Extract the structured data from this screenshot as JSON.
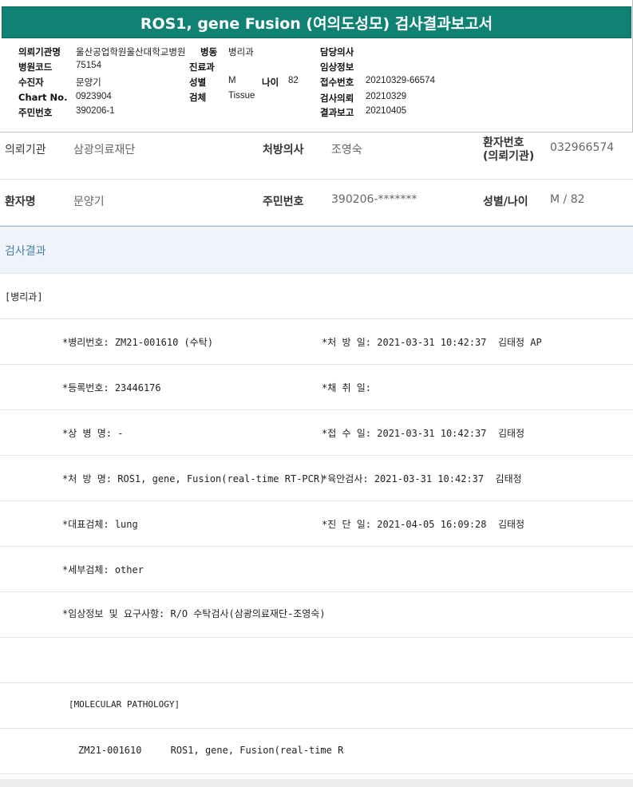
{
  "report": {
    "title": "ROS1, gene Fusion (여의도성모) 검사결과보고서"
  },
  "header": {
    "institution_label": "의뢰기관명",
    "institution_value": "울산공업학원울산대학교병원",
    "ward_label": "병동",
    "ward_value": "병리과",
    "doctor_label": "담당의사",
    "doctor_value": "",
    "hospital_code_label": "병원코드",
    "hospital_code_value": "75154",
    "department_label": "진료과",
    "department_value": "",
    "clinical_info_label": "임상정보",
    "clinical_info_value": "",
    "patient_label": "수진자",
    "patient_value": "문양기",
    "sex_label": "성별",
    "sex_value": "M",
    "age_label": "나이",
    "age_value": "82",
    "receipt_no_label": "접수번호",
    "receipt_no_value": "20210329-66574",
    "chart_label": "Chart No.",
    "chart_value": "0923904",
    "specimen_label": "검체",
    "specimen_value": "Tissue",
    "request_label": "검사의뢰",
    "request_value": "20210329",
    "resident_label": "주민번호",
    "resident_value": "390206-1",
    "result_report_label": "결과보고",
    "result_report_value": "20210405"
  },
  "info": {
    "institution_label": "의뢰기관",
    "institution_value": "삼광의료재단",
    "prescriber_label": "처방의사",
    "prescriber_value": "조영숙",
    "patient_no_label_1": "환자번호",
    "patient_no_label_2": "(의뢰기관)",
    "patient_no_value": "032966574",
    "patient_name_label": "환자명",
    "patient_name_value": "문양기",
    "resident_label": "주민번호",
    "resident_value": "390206-*******",
    "sexage_label": "성별/나이",
    "sexage_value": "M / 82"
  },
  "results": {
    "section_title": "검사결과",
    "department": "[병리과]",
    "pathology_no": "*병리번호: ZM21-001610 (수탁)",
    "prescribe_date": "*처 방 일: 2021-03-31 10:42:37  김태정 AP",
    "registration_no": "*등록번호: 23446176",
    "collect_date": "*채 취 일:",
    "disease_name": "*상 병 명: -",
    "receipt_date": "*접 수 일: 2021-03-31 10:42:37  김태정",
    "prescription_name": "*처 방 명: ROS1, gene, Fusion(real-time RT-PCR)",
    "gross_exam": "*육안검사: 2021-03-31 10:42:37  김태정",
    "main_specimen": "*대표검체: lung",
    "diagnosis_date": "*진 단 일: 2021-04-05 16:09:28  김태정",
    "sub_specimen": "*세부검체: other",
    "clinical_request": "*임상정보 및 요구사항: R/O 수탁검사(삼광의료재단-조영숙)",
    "molecular_header": "[MOLECULAR PATHOLOGY]",
    "molecular_line": "ZM21-001610     ROS1, gene, Fusion(real-time R"
  },
  "colors": {
    "title_bg": "#0f8274",
    "section_bg": "#eef4f9",
    "section_text": "#4a7fa8"
  }
}
